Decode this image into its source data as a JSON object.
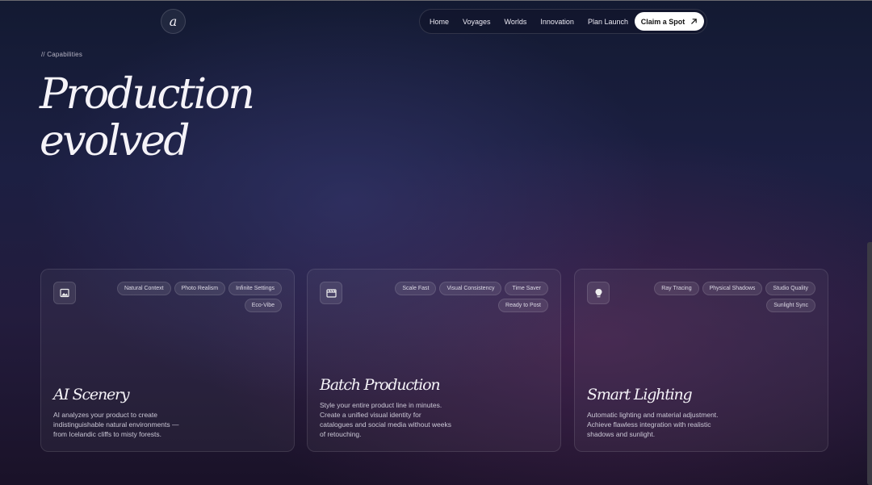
{
  "brand": {
    "logo_letter": "a"
  },
  "nav": {
    "links": [
      "Home",
      "Voyages",
      "Worlds",
      "Innovation",
      "Plan Launch"
    ],
    "cta_label": "Claim a Spot"
  },
  "hero": {
    "eyebrow": "// Capabilities",
    "title_line1": "Production",
    "title_line2": "evolved"
  },
  "cards": [
    {
      "icon": "image-icon",
      "tags": [
        "Natural Context",
        "Photo Realism",
        "Infinite Settings",
        "Eco-Vibe"
      ],
      "title": "AI Scenery",
      "description": "AI analyzes your product to create indistinguishable natural environments — from Icelandic cliffs to misty forests."
    },
    {
      "icon": "clapperboard-icon",
      "tags": [
        "Scale Fast",
        "Visual Consistency",
        "Time Saver",
        "Ready to Post"
      ],
      "title": "Batch Production",
      "description": "Style your entire product line in minutes. Create a unified visual identity for catalogues and social media without weeks of retouching."
    },
    {
      "icon": "lightbulb-icon",
      "tags": [
        "Ray Tracing",
        "Physical Shadows",
        "Studio Quality",
        "Sunlight Sync"
      ],
      "title": "Smart Lighting",
      "description": "Automatic lighting and material adjustment. Achieve flawless integration with realistic shadows and sunlight."
    }
  ]
}
